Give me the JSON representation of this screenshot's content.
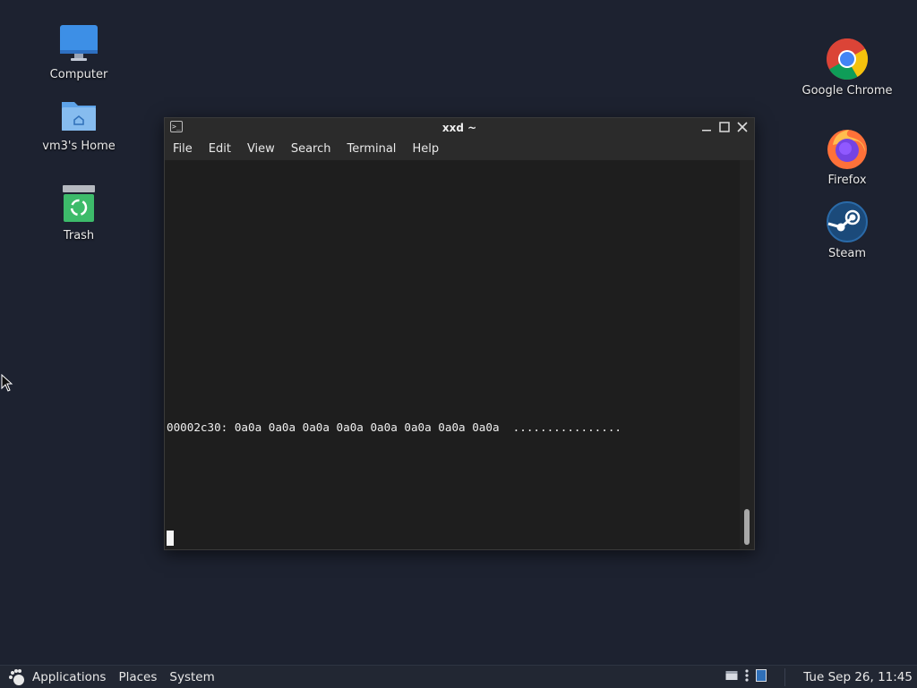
{
  "desktop": {
    "icons_left": [
      {
        "label": "Computer",
        "icon": "monitor-icon"
      },
      {
        "label": "vm3's Home",
        "icon": "home-folder-icon"
      },
      {
        "label": "Trash",
        "icon": "trash-icon"
      }
    ],
    "icons_right": [
      {
        "label": "Google Chrome",
        "icon": "chrome-icon"
      },
      {
        "label": "Firefox",
        "icon": "firefox-icon"
      },
      {
        "label": "Steam",
        "icon": "steam-icon"
      }
    ]
  },
  "terminal": {
    "title": "xxd ~",
    "menu": [
      "File",
      "Edit",
      "View",
      "Search",
      "Terminal",
      "Help"
    ],
    "output_line": "00002c30: 0a0a 0a0a 0a0a 0a0a 0a0a 0a0a 0a0a 0a0a  ................"
  },
  "taskbar": {
    "apps_label": "Applications",
    "places_label": "Places",
    "system_label": "System",
    "clock": "Tue Sep 26, 11:45"
  },
  "colors": {
    "desktop_bg": "#1d2230",
    "terminal_bg": "#1e1e1e",
    "titlebar_bg": "#2b2b2b",
    "taskbar_bg": "#222733"
  }
}
